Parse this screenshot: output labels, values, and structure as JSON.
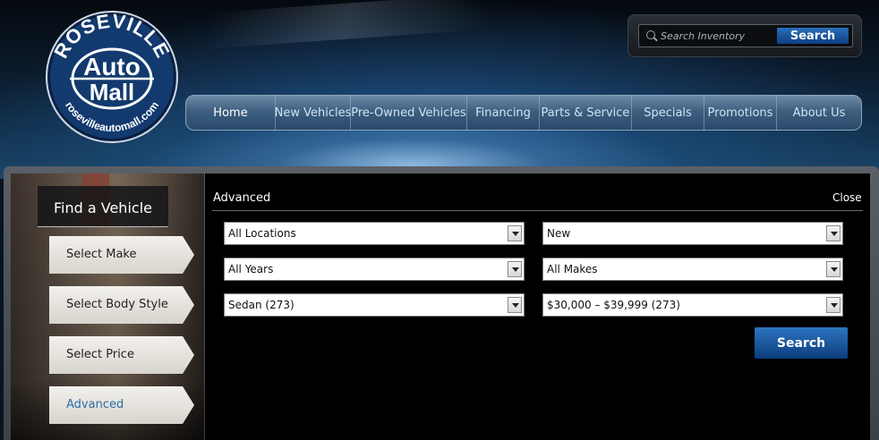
{
  "logo": {
    "top_text": "ROSEVILLE",
    "middle_text_1": "Auto",
    "middle_text_2": "Mall",
    "bottom_text": "rosevilleautomall.com"
  },
  "search": {
    "placeholder": "Search Inventory",
    "button_label": "Search"
  },
  "nav": {
    "items": [
      {
        "label": "Home"
      },
      {
        "label": "New Vehicles"
      },
      {
        "label": "Pre-Owned Vehicles"
      },
      {
        "label": "Financing"
      },
      {
        "label": "Parts & Service"
      },
      {
        "label": "Specials"
      },
      {
        "label": "Promotions"
      },
      {
        "label": "About Us"
      }
    ]
  },
  "finder": {
    "title": "Find a Vehicle",
    "buttons": [
      {
        "label": "Select Make"
      },
      {
        "label": "Select Body Style"
      },
      {
        "label": "Select Price"
      },
      {
        "label": "Advanced"
      }
    ]
  },
  "advanced": {
    "title": "Advanced",
    "close_label": "Close",
    "location": "All Locations",
    "condition": "New",
    "year": "All Years",
    "make": "All Makes",
    "body_style": "Sedan (273)",
    "price": "$30,000 – $39,999 (273)",
    "search_label": "Search"
  },
  "colors": {
    "accent_blue": "#0c3d7c",
    "advanced_link": "#2a6fa8"
  }
}
